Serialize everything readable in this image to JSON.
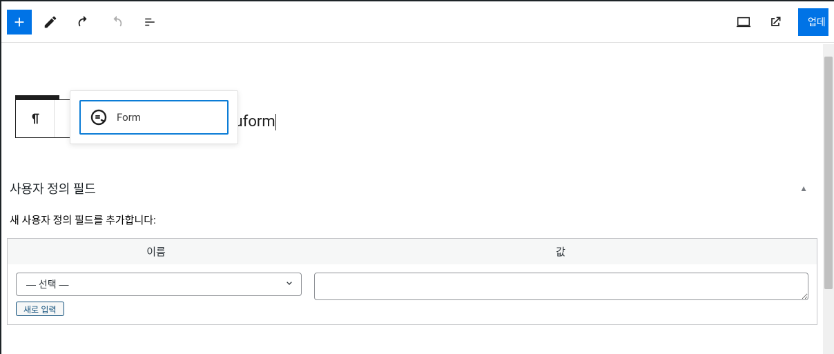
{
  "toolbar": {
    "update_label": "업데",
    "icons": {
      "add": "add",
      "edit": "edit",
      "undo": "undo",
      "redo": "redo",
      "outline": "outline",
      "desktop": "desktop",
      "external": "external"
    }
  },
  "editor": {
    "slash_text": "/quform",
    "block_suggestion": {
      "label": "Form",
      "icon": "quform-icon"
    },
    "block_toolbar_icon": "paragraph-icon"
  },
  "custom_fields": {
    "panel_title": "사용자 정의 필드",
    "add_new_heading": "새 사용자 정의 필드를 추가합니다:",
    "col_name": "이름",
    "col_value": "값",
    "select_placeholder": "— 선택 —",
    "new_input_button": "새로 입력"
  }
}
